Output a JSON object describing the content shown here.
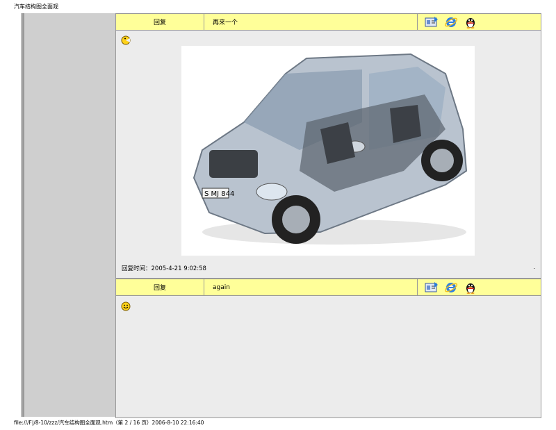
{
  "page": {
    "title": "汽车结构图全面观",
    "footer": "file:///F|/8-10/zzz/汽车结构图全面观.htm（第 2 / 16 页）2006-8-10 22:16:40"
  },
  "posts": [
    {
      "reply_label": "回复",
      "subject": "再来一个",
      "reply_time": "回复时间：2005-4-21 9:02:58",
      "trailing_mark": ".",
      "has_image": true,
      "icons": [
        "profile-card-icon",
        "ie-browser-icon",
        "qq-penguin-icon"
      ],
      "emoticon": "pacman-face-icon"
    },
    {
      "reply_label": "回复",
      "subject": "again",
      "icons": [
        "profile-card-icon",
        "ie-browser-icon",
        "qq-penguin-icon"
      ],
      "emoticon": "smile-face-icon"
    }
  ],
  "colors": {
    "header_bg": "#ffff99",
    "post_bg": "#ececec",
    "sidebar_bg": "#cfcfcf"
  }
}
